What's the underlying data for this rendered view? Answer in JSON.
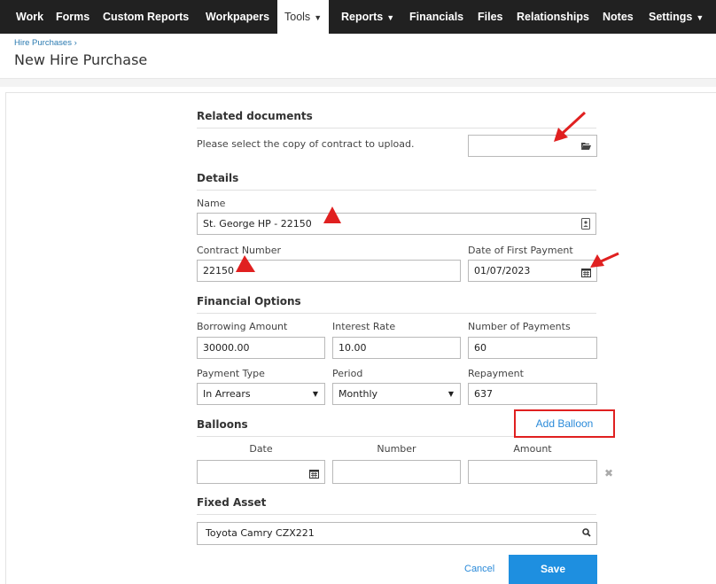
{
  "nav": {
    "items": [
      {
        "label": "Work"
      },
      {
        "label": "Forms"
      },
      {
        "label": "Custom Reports"
      },
      {
        "label": "Workpapers"
      },
      {
        "label": "Tools"
      },
      {
        "label": "Reports"
      },
      {
        "label": "Financials"
      },
      {
        "label": "Files"
      },
      {
        "label": "Relationships"
      },
      {
        "label": "Notes"
      },
      {
        "label": "Settings"
      }
    ]
  },
  "breadcrumb": "Hire Purchases ›",
  "page_title": "New Hire Purchase",
  "related": {
    "heading": "Related documents",
    "prompt": "Please select the copy of contract to upload.",
    "file_value": ""
  },
  "details": {
    "heading": "Details",
    "name_label": "Name",
    "name_value": "St. George HP - 22150",
    "contract_label": "Contract Number",
    "contract_value": "22150",
    "first_payment_label": "Date of First Payment",
    "first_payment_value": "01/07/2023"
  },
  "financial": {
    "heading": "Financial Options",
    "borrowing_label": "Borrowing Amount",
    "borrowing_value": "30000.00",
    "interest_label": "Interest Rate",
    "interest_value": "10.00",
    "payments_label": "Number of Payments",
    "payments_value": "60",
    "payment_type_label": "Payment Type",
    "payment_type_value": "In Arrears",
    "period_label": "Period",
    "period_value": "Monthly",
    "repayment_label": "Repayment",
    "repayment_value": "637"
  },
  "balloons": {
    "heading": "Balloons",
    "add_label": "Add Balloon",
    "col_date": "Date",
    "col_number": "Number",
    "col_amount": "Amount"
  },
  "fixed_asset": {
    "heading": "Fixed Asset",
    "value": "Toyota Camry CZX221"
  },
  "actions": {
    "cancel_label": "Cancel",
    "save_label": "Save"
  },
  "icons": {
    "caret": "caret-down-icon",
    "folder": "folder-open-icon",
    "calendar": "calendar-icon",
    "search": "search-icon",
    "remove": "close-icon",
    "autofill": "contact-card-icon"
  },
  "colors": {
    "nav_bg": "#212121",
    "link": "#2a8ad9",
    "primary": "#1e8fe0",
    "highlight": "#e02020"
  }
}
